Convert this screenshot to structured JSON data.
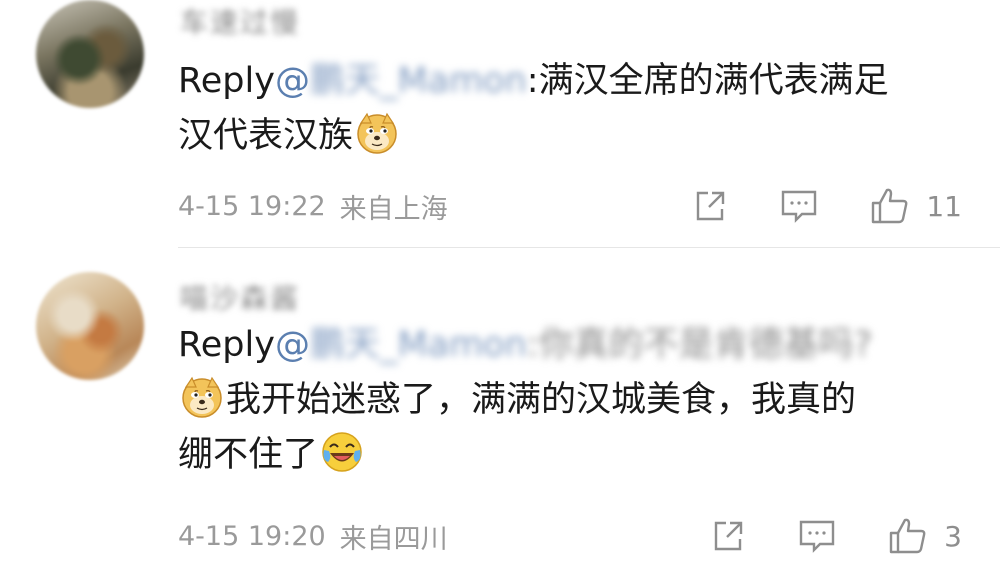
{
  "comments": [
    {
      "username": "车速过慢",
      "reply_label": "Reply",
      "mention": "@",
      "mention_name": "鹏天_Mamon",
      "colon": ":",
      "text_line1": "满汉全席的满代表满足",
      "text_line2": "汉代表汉族",
      "emoji_after": "doge-emoji",
      "date": "4-15 19:22",
      "location": "来自上海",
      "like_count": "11"
    },
    {
      "username": "喵沙森酱",
      "reply_label": "Reply",
      "mention": "@",
      "mention_name": "鹏天_Mamon",
      "mention_suffix": ":你真的不是肯德基吗?",
      "emoji_before": "doge-emoji",
      "text_line1": "我开始迷惑了，满满的汉城美食，我真的",
      "text_line2": "绷不住了",
      "emoji_after": "laugh-cry-emoji",
      "date": "4-15 19:20",
      "location": "来自四川",
      "like_count": "3"
    }
  ],
  "icons": {
    "share": "share-icon",
    "comment": "comment-icon",
    "like": "thumbs-up-icon"
  },
  "colors": {
    "mention": "#5b7fb0",
    "meta": "#9a9a9a",
    "icon": "#8e8e8e",
    "divider": "#e6e6e6"
  }
}
